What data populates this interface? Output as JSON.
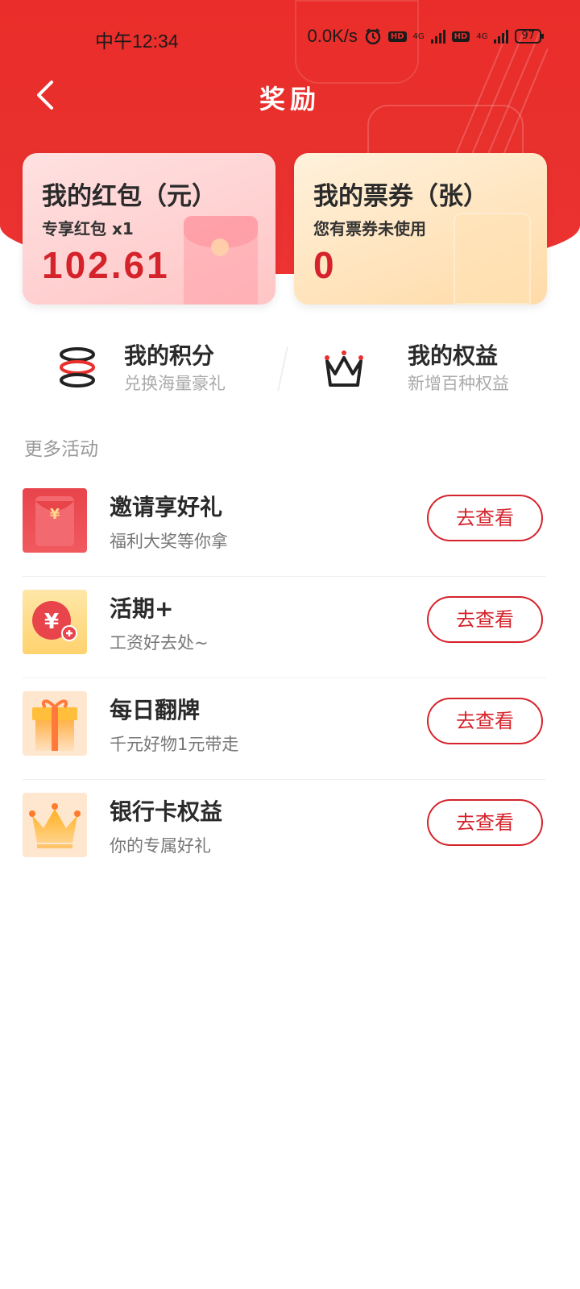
{
  "status_bar": {
    "time": "中午12:34",
    "speed": "0.0K/s",
    "hd1": "HD",
    "sig1": "4G",
    "hd2": "HD",
    "sig2": "4G",
    "battery": "97"
  },
  "header": {
    "title": "奖励"
  },
  "cards": {
    "redpacket": {
      "title": "我的红包（元）",
      "subtitle": "专享红包 x1",
      "value": "102.61"
    },
    "tickets": {
      "title": "我的票券（张）",
      "subtitle": "您有票券未使用",
      "value": "0"
    }
  },
  "quick_links": [
    {
      "label": "我的积分",
      "sub": "兑换海量豪礼"
    },
    {
      "label": "我的权益",
      "sub": "新增百种权益"
    }
  ],
  "section_title": "更多活动",
  "activities": [
    {
      "title": "邀请享好礼",
      "desc": "福利大奖等你拿",
      "button": "去查看",
      "icon": "red-envelope-icon"
    },
    {
      "title": "活期+",
      "desc": "工资好去处~",
      "button": "去查看",
      "icon": "yuan-coin-plus-icon"
    },
    {
      "title": "每日翻牌",
      "desc": "千元好物1元带走",
      "button": "去查看",
      "icon": "gift-box-icon"
    },
    {
      "title": "银行卡权益",
      "desc": "你的专属好礼",
      "button": "去查看",
      "icon": "crown-icon"
    }
  ],
  "colors": {
    "brand_red": "#e8302d",
    "accent_text_red": "#d5232b"
  }
}
